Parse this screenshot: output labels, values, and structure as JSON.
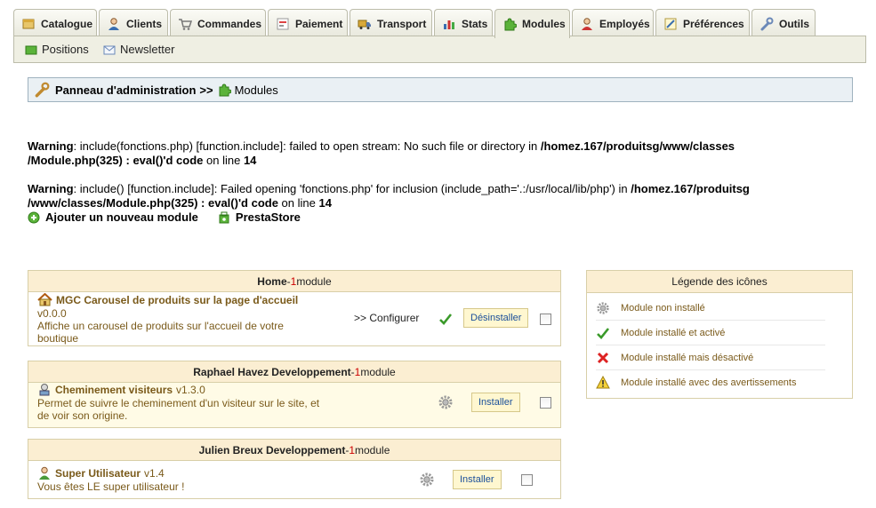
{
  "tabs": [
    {
      "label": "Catalogue",
      "icon": "catalogue-icon"
    },
    {
      "label": "Clients",
      "icon": "clients-icon"
    },
    {
      "label": "Commandes",
      "icon": "cart-icon"
    },
    {
      "label": "Paiement",
      "icon": "payment-icon"
    },
    {
      "label": "Transport",
      "icon": "truck-icon"
    },
    {
      "label": "Stats",
      "icon": "stats-icon"
    },
    {
      "label": "Modules",
      "icon": "puzzle-icon",
      "active": true
    },
    {
      "label": "Employés",
      "icon": "employee-icon"
    },
    {
      "label": "Préférences",
      "icon": "preferences-icon"
    },
    {
      "label": "Outils",
      "icon": "wrench-icon"
    }
  ],
  "subnav": [
    {
      "label": "Positions",
      "icon": "positions-icon"
    },
    {
      "label": "Newsletter",
      "icon": "envelope-icon"
    }
  ],
  "breadcrumb": {
    "root": "Panneau d'administration",
    "sep": ">>",
    "current": "Modules"
  },
  "warnings": [
    {
      "label": "Warning",
      "msg": ": include(fonctions.php) [function.include]: failed to open stream: No such file or directory in ",
      "path1": "/homez.167/produitsg/www/classes",
      "path2": "/Module.php(325) : eval()'d code",
      "online": " on line ",
      "line": "14"
    },
    {
      "label": "Warning",
      "msg": ": include() [function.include]: Failed opening 'fonctions.php' for inclusion (include_path='.:/usr/local/lib/php') in ",
      "path1": "/homez.167/produitsg",
      "path2": "/www/classes/Module.php(325) : eval()'d code",
      "online": " on line ",
      "line": "14"
    }
  ],
  "actions": {
    "add_module": "Ajouter un nouveau module",
    "prestastore": "PrestaStore"
  },
  "groups": [
    {
      "name": "Home",
      "sep": " - ",
      "count": "1",
      "unit": " module",
      "module": {
        "title": "MGC Carousel de produits sur la page d'accueil",
        "version": "",
        "line2": "v0.0.0",
        "desc1": "Affiche un carousel de produits sur l'accueil de votre",
        "desc2": "boutique",
        "configure": ">> Configurer",
        "button": "Désinstaller"
      }
    },
    {
      "name": "Raphael Havez Developpement",
      "sep": " - ",
      "count": "1",
      "unit": " module",
      "module": {
        "title": "Cheminement visiteurs",
        "version": "v1.3.0",
        "desc1": "Permet de suivre le cheminement d'un visiteur sur le site, et",
        "desc2": "de voir son origine.",
        "button": "Installer"
      }
    },
    {
      "name": "Julien Breux Developpement",
      "sep": " - ",
      "count": "1",
      "unit": " module",
      "module": {
        "title": "Super Utilisateur",
        "version": "v1.4",
        "desc1": "Vous êtes LE super utilisateur !",
        "button": "Installer"
      }
    }
  ],
  "legend": {
    "title": "Légende des icônes",
    "items": [
      {
        "label": "Module non installé",
        "icon": "gear-icon"
      },
      {
        "label": "Module installé et activé",
        "icon": "check-icon"
      },
      {
        "label": "Module installé mais désactivé",
        "icon": "cross-icon"
      },
      {
        "label": "Module installé avec des avertissements",
        "icon": "warning-icon"
      }
    ]
  },
  "colors": {
    "accent_brown": "#7a5a1a",
    "count_red": "#cc0000",
    "link_blue": "#1a4f9a",
    "group_header": "#fbeed2"
  }
}
